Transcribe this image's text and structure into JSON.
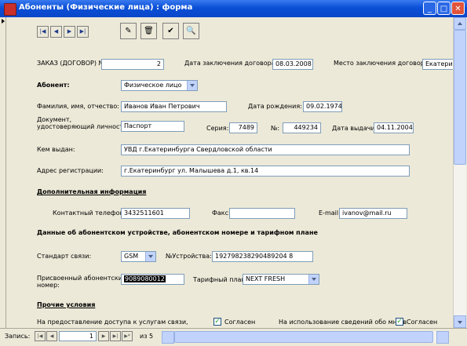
{
  "window": {
    "title": "Абоненты (Физические лица) : форма"
  },
  "nav_buttons": [
    "first-record",
    "previous-record",
    "next-record",
    "last-record"
  ],
  "toolbar": [
    "edit-icon",
    "delete-icon",
    "save-icon",
    "find-icon"
  ],
  "form": {
    "order": {
      "label": "ЗАКАЗ (ДОГОВОР) №",
      "value": "2"
    },
    "contract_date": {
      "label": "Дата заключения договора:",
      "value": "08.03.2008"
    },
    "contract_place": {
      "label": "Место заключения договора:",
      "value": "Екатерин"
    },
    "subscriber": {
      "label": "Абонент:",
      "value": "Физическое лицо"
    },
    "full_name": {
      "label": "Фамилия, имя, отчество:",
      "value": "Иванов Иван Петрович"
    },
    "birth_date": {
      "label": "Дата рождения:",
      "value": "09.02.1974"
    },
    "document": {
      "label_line1": "Документ,",
      "label_line2": "удостоверяющий личность:",
      "value": "Паспорт"
    },
    "series": {
      "label": "Серия:",
      "value": "7489"
    },
    "number": {
      "label": "№:",
      "value": "449234"
    },
    "issue_date": {
      "label": "Дата выдачи:",
      "value": "04.11.2004"
    },
    "issued_by": {
      "label": "Кем выдан:",
      "value": "УВД г.Екатеринбурга Свердловской области"
    },
    "address": {
      "label": "Адрес регистрации:",
      "value": "г.Екатеринбург ул. Малышева д.1, кв.14"
    },
    "section_additional": "Дополнительная информация",
    "phone": {
      "label": "Контактный телефон:",
      "value": "3432511601"
    },
    "fax": {
      "label": "Факс:",
      "value": ""
    },
    "email": {
      "label": "E-mail:",
      "value": "ivanov@mail.ru"
    },
    "section_device": "Данные об абонентском устройстве, абонентском номере и тарифном плане",
    "standard": {
      "label": "Стандарт связи:",
      "value": "GSM"
    },
    "device_no": {
      "label": "№Устройства:",
      "value": "192798238290489204 8"
    },
    "assigned_number": {
      "label_line1": "Присвоенный абонентский",
      "label_line2": "номер:",
      "value": "9089080012"
    },
    "tariff": {
      "label": "Тарифный план:",
      "value": "NEXT FRESH"
    },
    "section_other": "Прочие условия",
    "access_text": "На предоставление доступа к услугам связи,",
    "agree1": "Согласен",
    "use_info_text": "На использование сведений обо мне в",
    "agree2": "Согласен"
  },
  "statusbar": {
    "record_label": "Запись:",
    "current": "1",
    "of_label": "из 5"
  }
}
